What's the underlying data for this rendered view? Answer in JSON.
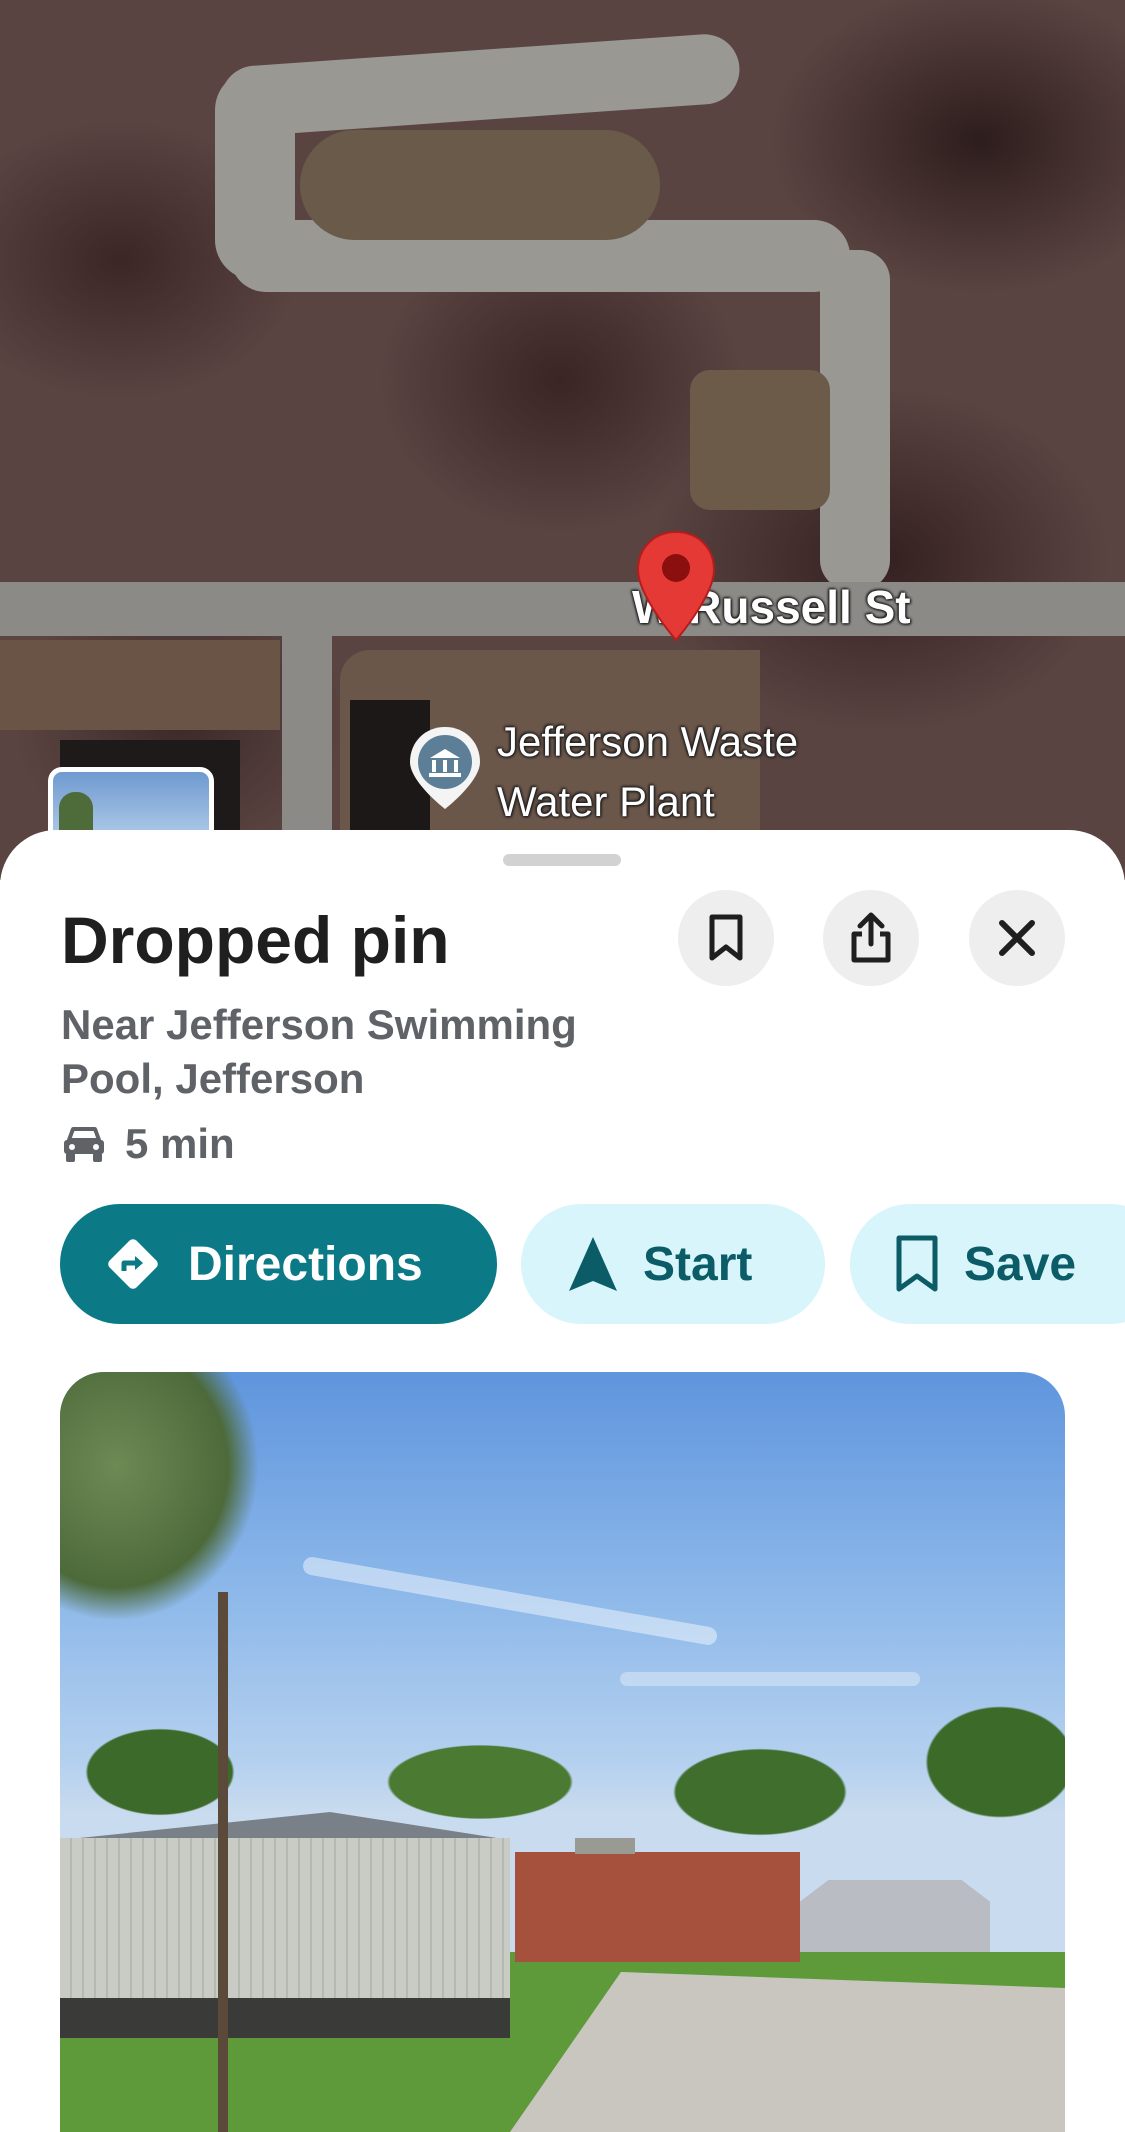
{
  "map": {
    "street_label": "W Russell St",
    "poi_label_line1": "Jefferson Waste",
    "poi_label_line2": "Water Plant",
    "pin_icon": "red-location-pin-icon",
    "poi_icon": "government-building-icon"
  },
  "place": {
    "title": "Dropped pin",
    "subtitle": "Near Jefferson Swimming Pool, Jefferson",
    "eta": "5 min",
    "eta_icon": "car-icon"
  },
  "header_buttons": {
    "bookmark_icon": "bookmark-icon",
    "share_icon": "share-icon",
    "close_icon": "close-icon"
  },
  "actions": {
    "directions": "Directions",
    "start": "Start",
    "save": "Save"
  },
  "colors": {
    "accent": "#0b7a86",
    "accent_light": "#d7f5fb",
    "pin_red": "#e53935"
  }
}
